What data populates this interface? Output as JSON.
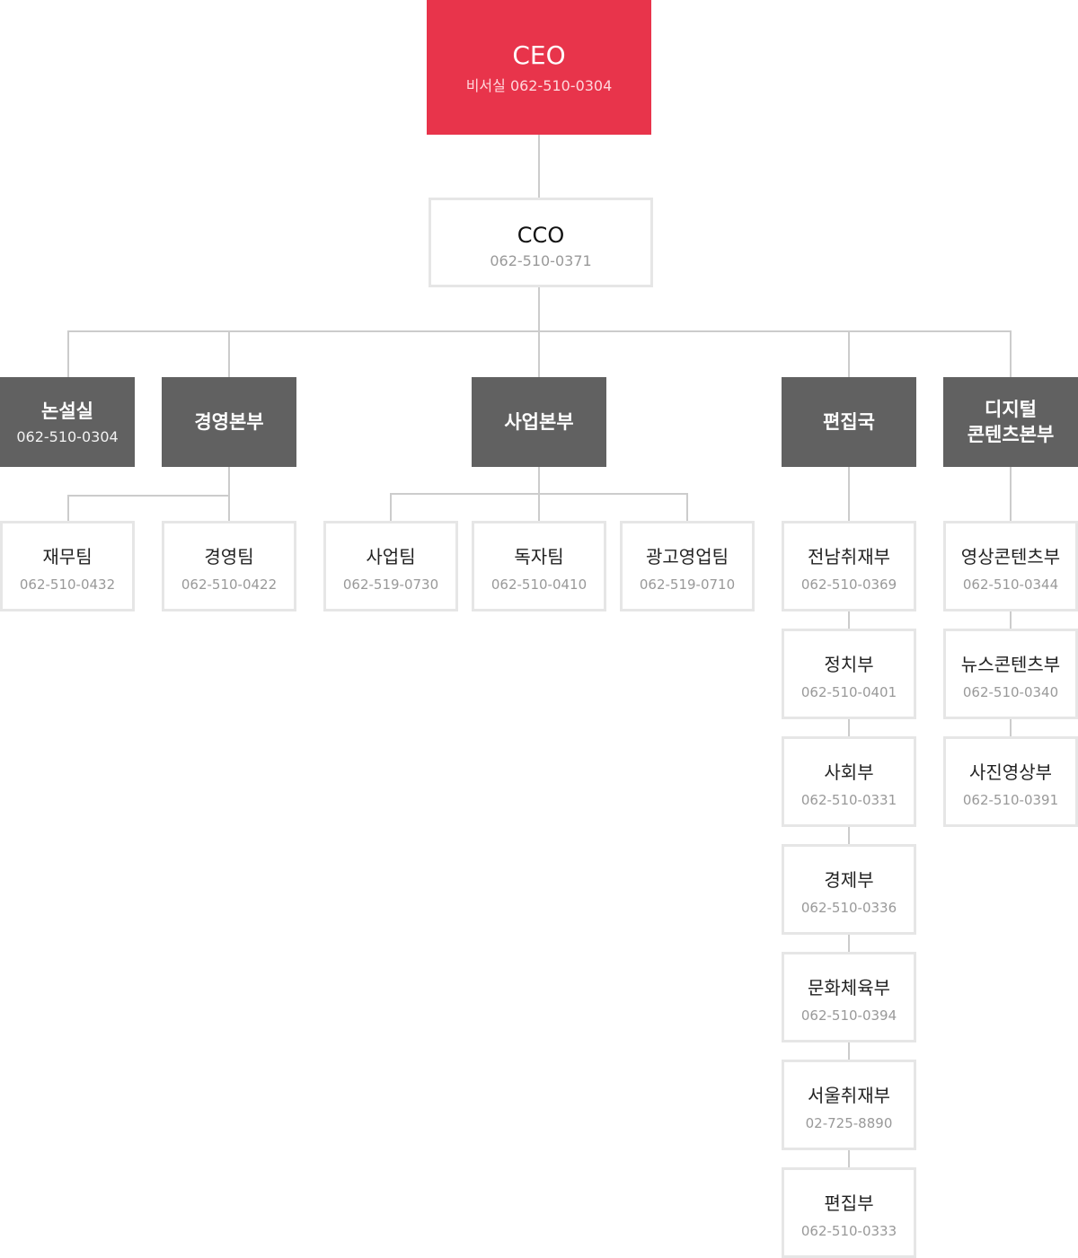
{
  "colors": {
    "ceo": "#e8344b",
    "division": "#616161",
    "line": "#cccccc",
    "border": "#e6e6e6"
  },
  "ceo": {
    "name": "CEO",
    "phone": "비서실 062-510-0304"
  },
  "cco": {
    "name": "CCO",
    "phone": "062-510-0371"
  },
  "divisions": [
    {
      "name": "논설실",
      "phone": "062-510-0304"
    },
    {
      "name": "경영본부"
    },
    {
      "name": "사업본부"
    },
    {
      "name": "편집국"
    },
    {
      "name": "디지털\n콘텐츠본부"
    }
  ],
  "teams": {
    "management": [
      {
        "name": "재무팀",
        "phone": "062-510-0432"
      },
      {
        "name": "경영팀",
        "phone": "062-510-0422"
      }
    ],
    "business": [
      {
        "name": "사업팀",
        "phone": "062-519-0730"
      },
      {
        "name": "독자팀",
        "phone": "062-510-0410"
      },
      {
        "name": "광고영업팀",
        "phone": "062-519-0710"
      }
    ],
    "editorial": [
      {
        "name": "전남취재부",
        "phone": "062-510-0369"
      },
      {
        "name": "정치부",
        "phone": "062-510-0401"
      },
      {
        "name": "사회부",
        "phone": "062-510-0331"
      },
      {
        "name": "경제부",
        "phone": "062-510-0336"
      },
      {
        "name": "문화체육부",
        "phone": "062-510-0394"
      },
      {
        "name": "서울취재부",
        "phone": "02-725-8890"
      },
      {
        "name": "편집부",
        "phone": "062-510-0333"
      }
    ],
    "digital": [
      {
        "name": "영상콘텐츠부",
        "phone": "062-510-0344"
      },
      {
        "name": "뉴스콘텐츠부",
        "phone": "062-510-0340"
      },
      {
        "name": "사진영상부",
        "phone": "062-510-0391"
      }
    ]
  }
}
